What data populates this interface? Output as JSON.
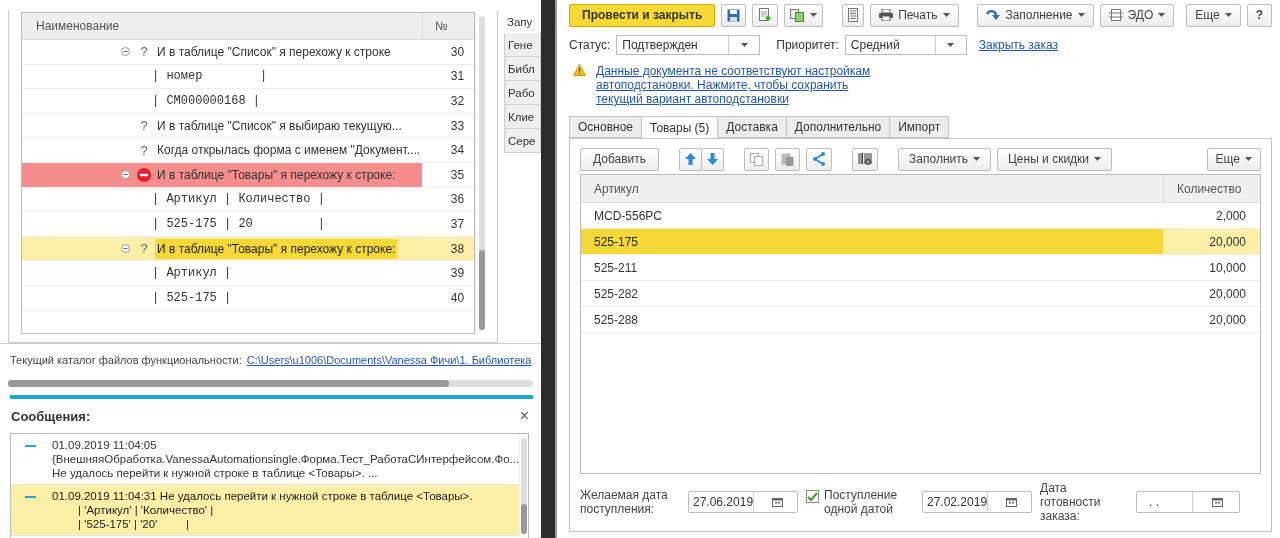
{
  "tree": {
    "columns": [
      "Наименование",
      "№"
    ],
    "rows": [
      {
        "kind": "step",
        "number": "30",
        "mark": "?",
        "text": "И в таблице \"Список\" я перехожу к строке",
        "expanded": true,
        "failed": false,
        "selected": false,
        "children": [
          {
            "kind": "table",
            "number": "31",
            "text": "| номер        |"
          },
          {
            "kind": "table",
            "number": "32",
            "text": "| СМ000000168 |"
          }
        ]
      },
      {
        "kind": "step",
        "number": "33",
        "mark": "?",
        "text": "И в таблице \"Список\" я выбираю текущую...",
        "failed": false,
        "selected": false
      },
      {
        "kind": "step",
        "number": "34",
        "mark": "?",
        "text": "Когда открылась форма с именем \"Документ....",
        "failed": false,
        "selected": false
      },
      {
        "kind": "step",
        "number": "35",
        "text": "И в таблице \"Товары\" я перехожу к строке:",
        "expanded": true,
        "failed": true,
        "selected": false,
        "children": [
          {
            "kind": "table",
            "number": "36",
            "text": "| Артикул | Количество |"
          },
          {
            "kind": "table",
            "number": "37",
            "text": "| 525-175 | 20         |"
          }
        ]
      },
      {
        "kind": "step",
        "number": "38",
        "mark": "?",
        "text": "И в таблице \"Товары\" я перехожу к строке:",
        "expanded": true,
        "failed": false,
        "selected": true,
        "children": [
          {
            "kind": "table",
            "number": "39",
            "text": "| Артикул |"
          },
          {
            "kind": "table",
            "number": "40",
            "text": "| 525-175 |"
          }
        ]
      }
    ]
  },
  "side_tabs": [
    {
      "label": "Запу",
      "selected": true
    },
    {
      "label": "Гене",
      "selected": false
    },
    {
      "label": "Библ",
      "selected": false
    },
    {
      "label": "Рабо",
      "selected": false
    },
    {
      "label": "Клие",
      "selected": false
    },
    {
      "label": "Сере",
      "selected": false
    }
  ],
  "path": {
    "label": "Текущий каталог файлов функциональности:",
    "link": "C:\\Users\\u1006\\Documents\\Vanessa Фичи\\1. Библиотека"
  },
  "messages": {
    "title": "Сообщения:",
    "close": "×",
    "items": [
      {
        "kind": "text",
        "selected": false,
        "lines": [
          "01.09.2019 11:04:05",
          "{ВнешняяОбработка.VanessaAutomationsingle.Форма.Тест_РаботаСИнтерфейсом.Фо...",
          "Не удалось перейти к нужной строке в таблице <Товары>. ..."
        ]
      },
      {
        "kind": "table",
        "selected": true,
        "lines": [
          "01.09.2019 11:04:31 Не удалось перейти к нужной строке в таблице <Товары>.",
          "| 'Артикул' | 'Количество' |",
          "| '525-175' | '20'         |"
        ]
      }
    ]
  },
  "form": {
    "toolbar": {
      "primary": "Провести и закрыть",
      "print": "Печать",
      "fill": "Заполнение",
      "edo": "ЭДО",
      "more": "Еще",
      "help": "?"
    },
    "status": {
      "label": "Статус:",
      "value": "Подтвержден"
    },
    "priority": {
      "label": "Приоритет:",
      "value": "Средний"
    },
    "close_link": "Закрыть заказ",
    "warning": "Данные документа не соответствуют настройкам автоподстановки. Нажмите, чтобы сохранить текущий вариант автоподстановки",
    "tabs": [
      {
        "label": "Основное",
        "selected": false
      },
      {
        "label": "Товары (5)",
        "selected": true
      },
      {
        "label": "Доставка",
        "selected": false
      },
      {
        "label": "Дополнительно",
        "selected": false
      },
      {
        "label": "Импорт",
        "selected": false
      }
    ],
    "table_toolbar": {
      "add": "Добавить",
      "fill": "Заполнить",
      "prices": "Цены и скидки",
      "more": "Еще"
    },
    "table": {
      "columns": [
        "Артикул",
        "Количество"
      ],
      "rows": [
        {
          "article": "MCD-556PC",
          "quantity": "2,000",
          "selected": false
        },
        {
          "article": "525-175",
          "quantity": "20,000",
          "selected": true
        },
        {
          "article": "525-211",
          "quantity": "10,000",
          "selected": false
        },
        {
          "article": "525-282",
          "quantity": "20,000",
          "selected": false
        },
        {
          "article": "525-288",
          "quantity": "20,000",
          "selected": false
        }
      ]
    },
    "footer": {
      "desired_date": {
        "label": "Желаемая дата поступления:",
        "value": "27.06.2019"
      },
      "single_date": {
        "label": "Поступление одной датой",
        "checked": true,
        "value": "27.02.2019"
      },
      "ready_date": {
        "label": "Дата готовности заказа:",
        "value": ".  ."
      }
    }
  }
}
